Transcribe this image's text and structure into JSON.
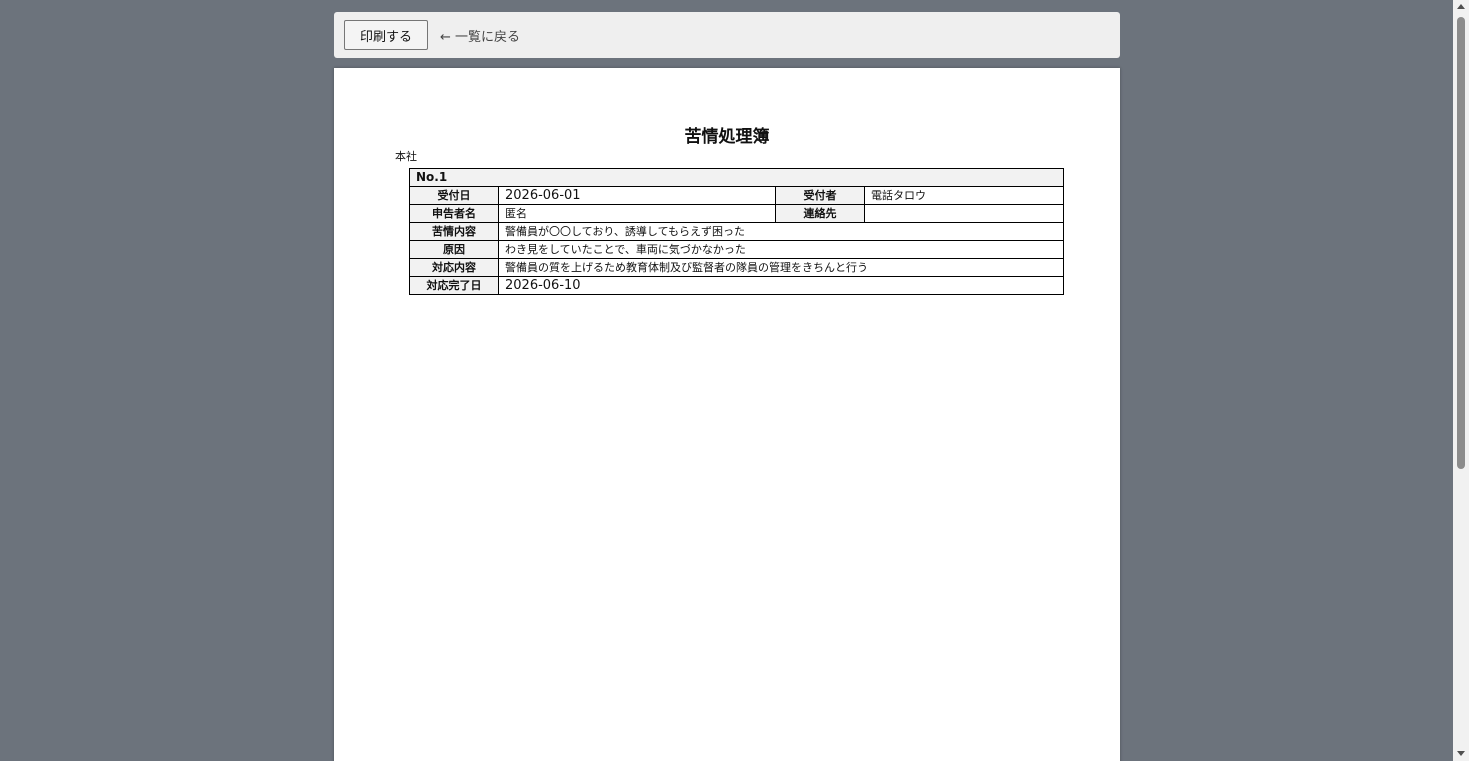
{
  "toolbar": {
    "print_label": "印刷する",
    "back_label": "← 一覧に戻る"
  },
  "document": {
    "title": "苦情処理簿",
    "branch": "本社",
    "record": {
      "number": "No.1",
      "received_date_label": "受付日",
      "received_date": "2026-06-01",
      "receiver_label": "受付者",
      "receiver": "電話タロウ",
      "applicant_label": "申告者名",
      "applicant": "匿名",
      "contact_label": "連絡先",
      "contact": "",
      "complaint_label": "苦情内容",
      "complaint": "警備員が〇〇しており、誘導してもらえず困った",
      "cause_label": "原因",
      "cause": "わき見をしていたことで、車両に気づかなかった",
      "response_label": "対応内容",
      "response": "警備員の質を上げるため教育体制及び監督者の隊員の管理をきちんと行う",
      "completion_date_label": "対応完了日",
      "completion_date": "2026-06-10"
    }
  },
  "colors": {
    "background": "#6c737c",
    "toolbar": "#efefef",
    "page": "#ffffff",
    "header_cell": "#f2f2f2"
  }
}
